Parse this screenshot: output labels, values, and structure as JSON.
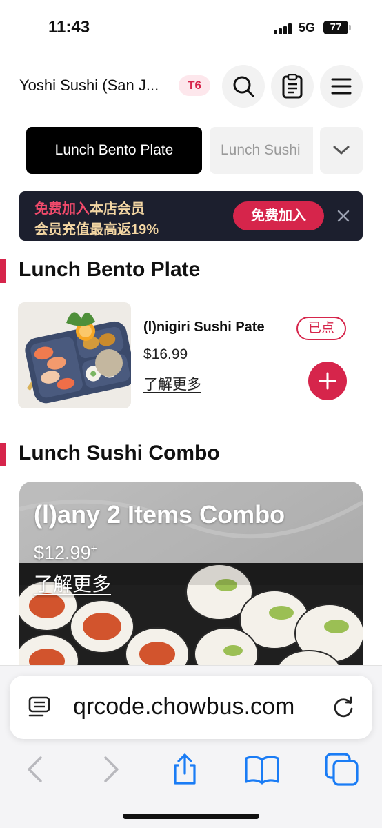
{
  "status_bar": {
    "time": "11:43",
    "network": "5G",
    "battery": "77"
  },
  "header": {
    "store_name": "Yoshi Sushi (San J...",
    "table": "T6",
    "icons": [
      "search-icon",
      "order-list-icon",
      "menu-icon"
    ]
  },
  "tabs": {
    "active": "Lunch Bento Plate",
    "next": "Lunch Sushi",
    "more_icon": "chevron-down-icon"
  },
  "promo": {
    "line1_highlight": "免费加入",
    "line1_rest": "本店会员",
    "line2": "会员充值最高返19%",
    "join_label": "免费加入",
    "close_icon": "close-icon"
  },
  "sections": [
    {
      "title": "Lunch Bento Plate",
      "items": [
        {
          "name": "(l)nigiri Sushi Pate",
          "price": "$16.99",
          "more": "了解更多",
          "badge": "已点"
        }
      ]
    },
    {
      "title": "Lunch Sushi Combo",
      "items": [
        {
          "name": "(l)any 2 Items Combo",
          "price": "$12.99",
          "price_suffix": "+",
          "more": "了解更多"
        }
      ]
    }
  ],
  "browser": {
    "url": "qrcode.chowbus.com",
    "icons": [
      "reader-icon",
      "reload-icon",
      "back-icon",
      "forward-icon",
      "share-icon",
      "bookmarks-icon",
      "tabs-icon"
    ]
  },
  "colors": {
    "accent": "#d6254b",
    "promo_bg": "#1c1f2e",
    "promo_text": "#f3d6a3",
    "ios_blue": "#1a7cf5"
  }
}
